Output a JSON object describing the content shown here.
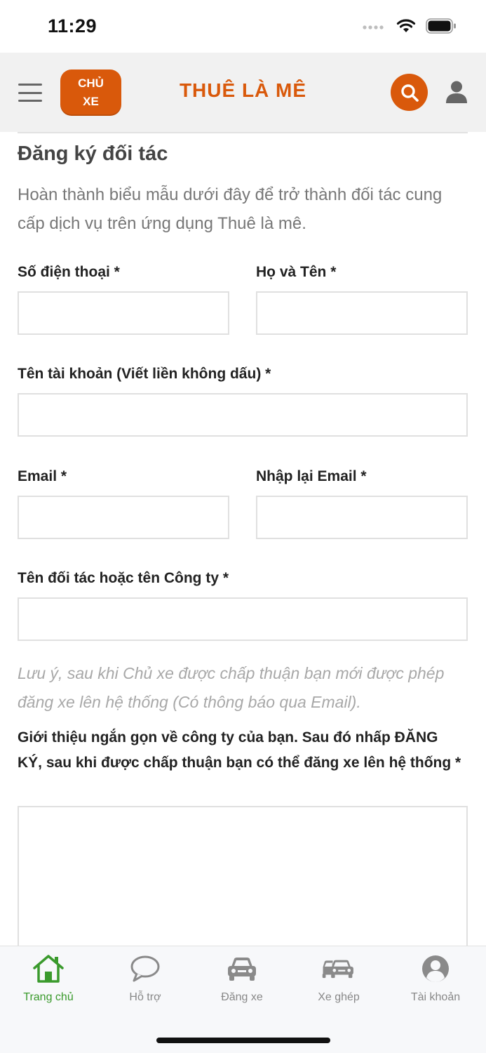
{
  "status_bar": {
    "time": "11:29"
  },
  "header": {
    "owner_badge_line1": "CHỦ",
    "owner_badge_line2": "XE",
    "brand": "THUÊ LÀ MÊ"
  },
  "form": {
    "title": "Đăng ký đối tác",
    "intro": "Hoàn thành biểu mẫu dưới đây để trở thành đối tác cung cấp dịch vụ trên ứng dụng Thuê là mê.",
    "phone_label": "Số điện thoại *",
    "phone_value": "",
    "fullname_label": "Họ và Tên *",
    "fullname_value": "",
    "username_label": "Tên tài khoản (Viết liền không dấu) *",
    "username_value": "",
    "email_label": "Email *",
    "email_value": "",
    "email_confirm_label": "Nhập lại Email *",
    "email_confirm_value": "",
    "company_label": "Tên đối tác hoặc tên Công ty *",
    "company_value": "",
    "note": "Lưu ý, sau khi Chủ xe được chấp thuận bạn mới được phép đăng xe lên hệ thống (Có thông báo qua Email).",
    "intro_field_label": "Giới thiệu ngắn gọn về công ty của bạn. Sau đó nhấp ĐĂNG KÝ, sau khi được chấp thuận bạn có thể đăng xe lên hệ thống *",
    "intro_field_value": ""
  },
  "tabbar": {
    "active_color": "#3a9a2c",
    "brand_color": "#d9590b",
    "items": [
      {
        "label": "Trang chủ",
        "icon": "home-icon",
        "active": true
      },
      {
        "label": "Hỗ trợ",
        "icon": "chat-bubble-icon",
        "active": false
      },
      {
        "label": "Đăng xe",
        "icon": "car-icon",
        "active": false
      },
      {
        "label": "Xe ghép",
        "icon": "two-cars-icon",
        "active": false
      },
      {
        "label": "Tài khoản",
        "icon": "account-circle-icon",
        "active": false
      }
    ]
  }
}
